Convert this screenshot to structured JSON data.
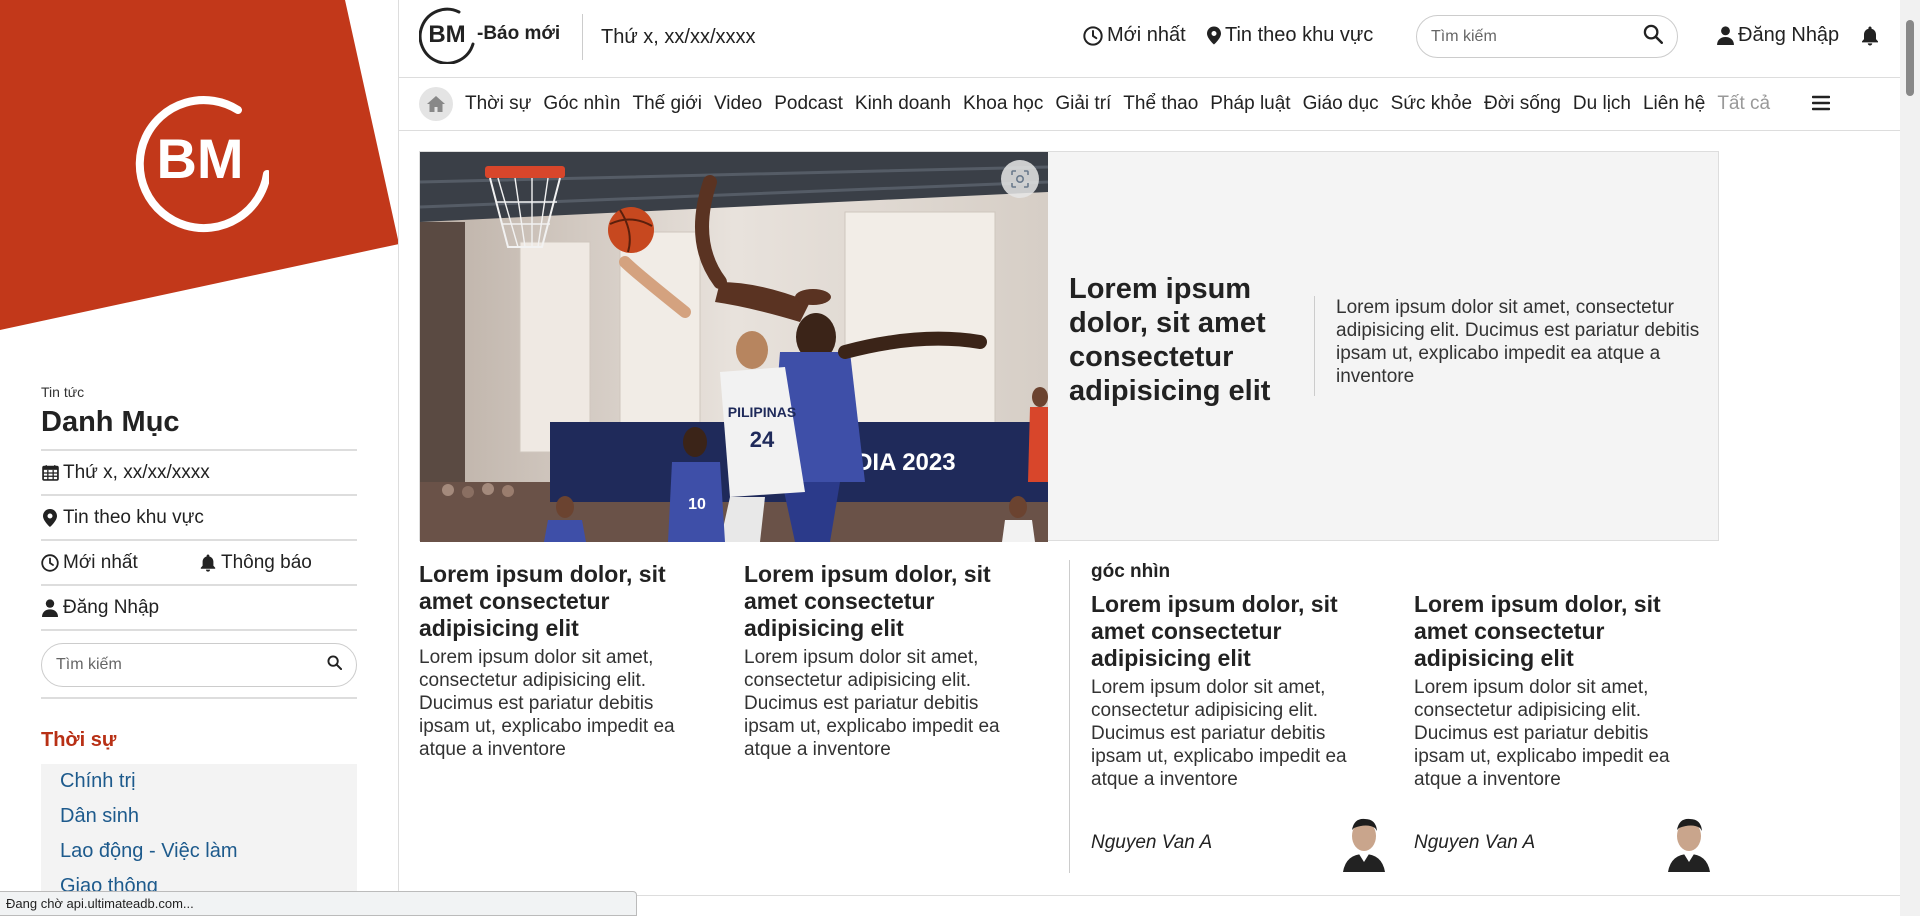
{
  "colors": {
    "brand_red": "#c2381a",
    "link_blue": "#1d5a8c",
    "category_red": "#b83015"
  },
  "brand": {
    "logo_text": "BM",
    "site_name": "-Báo mới"
  },
  "header": {
    "date": "Thứ x, xx/xx/xxxx",
    "latest_label": "Mới nhất",
    "region_label": "Tin theo khu vực",
    "search_placeholder": "Tìm kiếm",
    "login_label": "Đăng Nhập"
  },
  "nav": {
    "items": [
      "Thời sự",
      "Góc nhìn",
      "Thế giới",
      "Video",
      "Podcast",
      "Kinh doanh",
      "Khoa học",
      "Giải trí",
      "Thể thao",
      "Pháp luật",
      "Giáo dục",
      "Sức khỏe",
      "Đời sống",
      "Du lịch",
      "Liên hệ"
    ],
    "all_label": "Tất cả"
  },
  "sidebar": {
    "small_label": "Tin tức",
    "title": "Danh Mục",
    "date": "Thứ x, xx/xx/xxxx",
    "region": "Tin theo khu vực",
    "latest": "Mới nhất",
    "notifications": "Thông báo",
    "login": "Đăng Nhập",
    "search_placeholder": "Tìm kiếm",
    "category": "Thời sự",
    "subcategories": [
      "Chính trị",
      "Dân sinh",
      "Lao động - Việc làm",
      "Giao thông"
    ]
  },
  "feature": {
    "title": "Lorem ipsum dolor, sit amet consectetur adipisicing elit",
    "description": "Lorem ipsum dolor sit amet, consectetur adipisicing elit. Ducimus est pariatur debitis ipsam ut, explicabo impedit ea atque a inventore",
    "image_banner": "CAMBODIA 2023",
    "image_jersey_text": "PILIPINAS"
  },
  "cards": [
    {
      "title": "Lorem ipsum dolor, sit amet consectetur adipisicing elit",
      "description": "Lorem ipsum dolor sit amet, consectetur adipisicing elit. Ducimus est pariatur debitis ipsam ut, explicabo impedit ea atque a inventore"
    },
    {
      "title": "Lorem ipsum dolor, sit amet consectetur adipisicing elit",
      "description": "Lorem ipsum dolor sit amet, consectetur adipisicing elit. Ducimus est pariatur debitis ipsam ut, explicabo impedit ea atque a inventore"
    }
  ],
  "goc_nhin": {
    "label": "góc nhìn",
    "cards": [
      {
        "title": "Lorem ipsum dolor, sit amet consectetur adipisicing elit",
        "description": "Lorem ipsum dolor sit amet, consectetur adipisicing elit. Ducimus est pariatur debitis ipsam ut, explicabo impedit ea atque a inventore",
        "author": "Nguyen Van A"
      },
      {
        "title": "Lorem ipsum dolor, sit amet consectetur adipisicing elit",
        "description": "Lorem ipsum dolor sit amet, consectetur adipisicing elit. Ducimus est pariatur debitis ipsam ut, explicabo impedit ea atque a inventore",
        "author": "Nguyen Van A"
      }
    ]
  },
  "status_bar": {
    "text": "Đang chờ api.ultimateadb.com..."
  },
  "icons": [
    "home-icon",
    "clock-icon",
    "location-pin-icon",
    "search-icon",
    "user-icon",
    "bell-icon",
    "calendar-icon",
    "menu-icon",
    "scan-icon"
  ]
}
